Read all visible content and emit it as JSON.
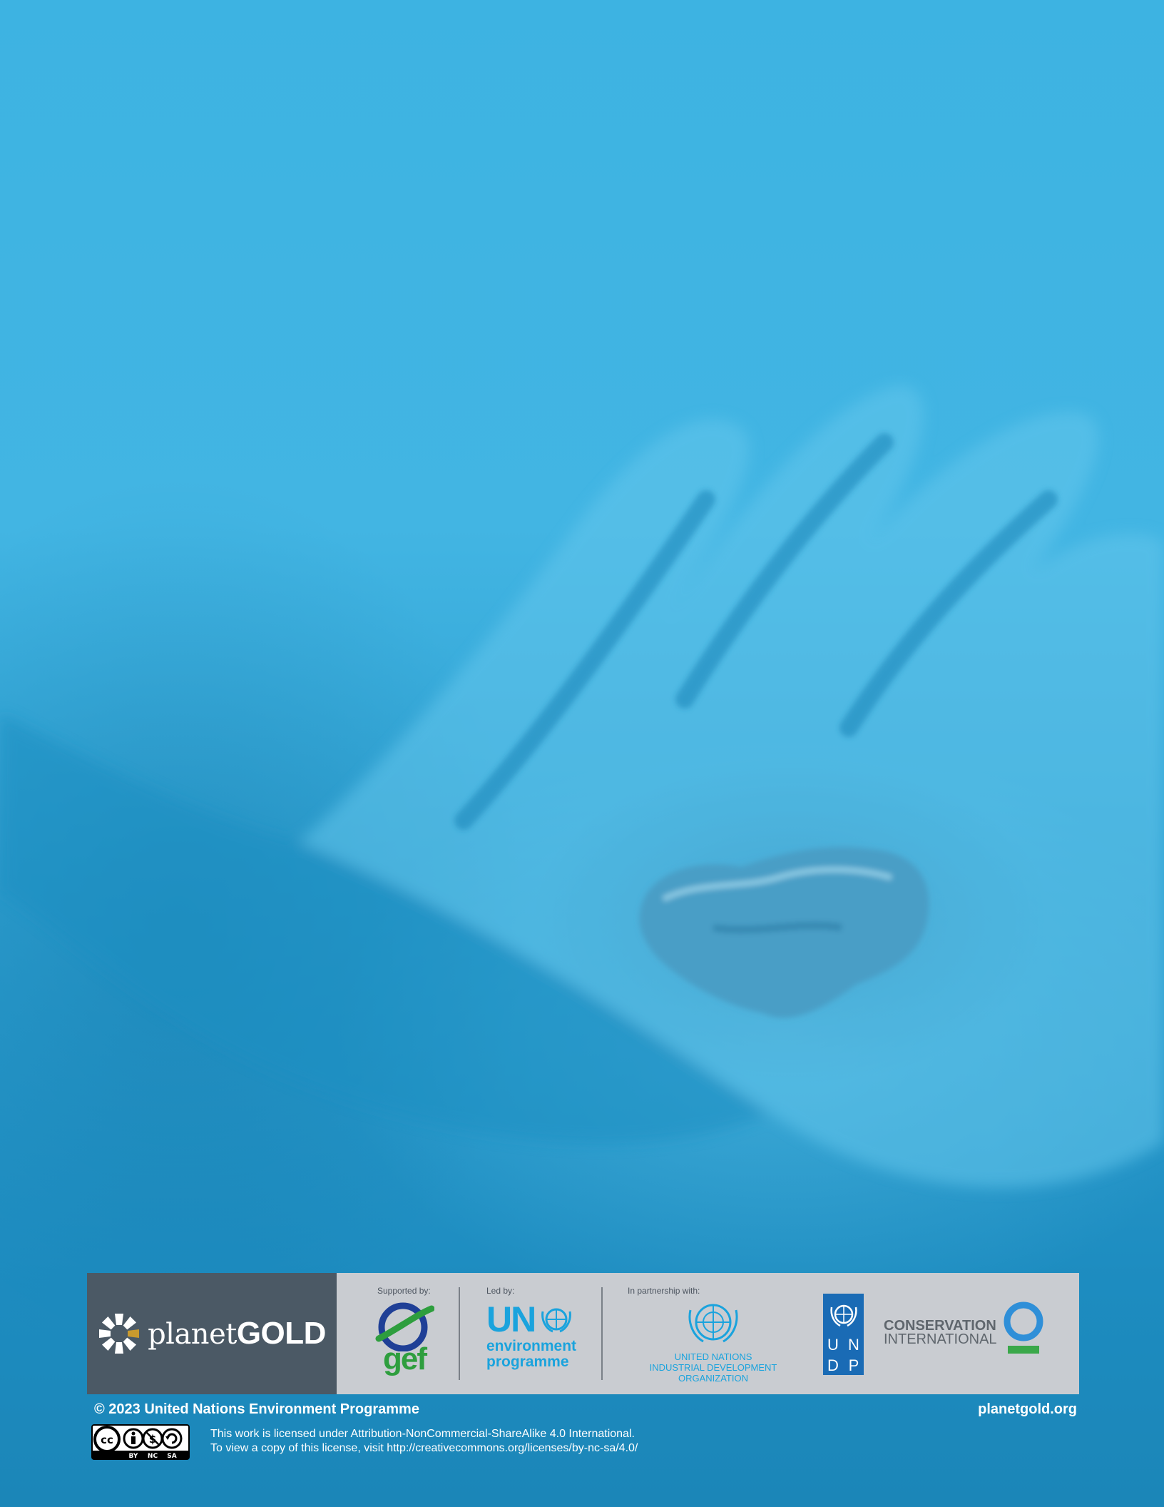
{
  "partners": {
    "planetgold_light": "planet",
    "planetgold_bold": "GOLD",
    "supported_by": "Supported by:",
    "led_by": "Led by:",
    "in_partnership_with": "In partnership with:",
    "gef": "gef",
    "un": "UN",
    "environment": "environment",
    "programme": "programme",
    "unido_line1": "UNITED NATIONS",
    "unido_line2": "INDUSTRIAL DEVELOPMENT ORGANIZATION",
    "undp_letters": [
      "U",
      "N",
      "D",
      "P"
    ],
    "ci_line1": "CONSERVATION",
    "ci_line2": "INTERNATIONAL"
  },
  "footer": {
    "copyright": "© 2023 United Nations Environment Programme",
    "website": "planetgold.org",
    "license_line1": "This work is licensed under Attribution-NonCommercial-ShareAlike 4.0 International.",
    "license_line2": "To view a copy of this license, visit http://creativecommons.org/licenses/by-nc-sa/4.0/",
    "cc_labels": [
      "BY",
      "NC",
      "SA"
    ]
  },
  "colors": {
    "background": "#2aa5d6",
    "band": "#c9ccd1",
    "planetgold_box": "#4b5965",
    "un_blue": "#1aa3dd",
    "gef_green": "#2e9e3e",
    "undp_blue": "#1a6bb5",
    "ci_green": "#3aa84a"
  }
}
